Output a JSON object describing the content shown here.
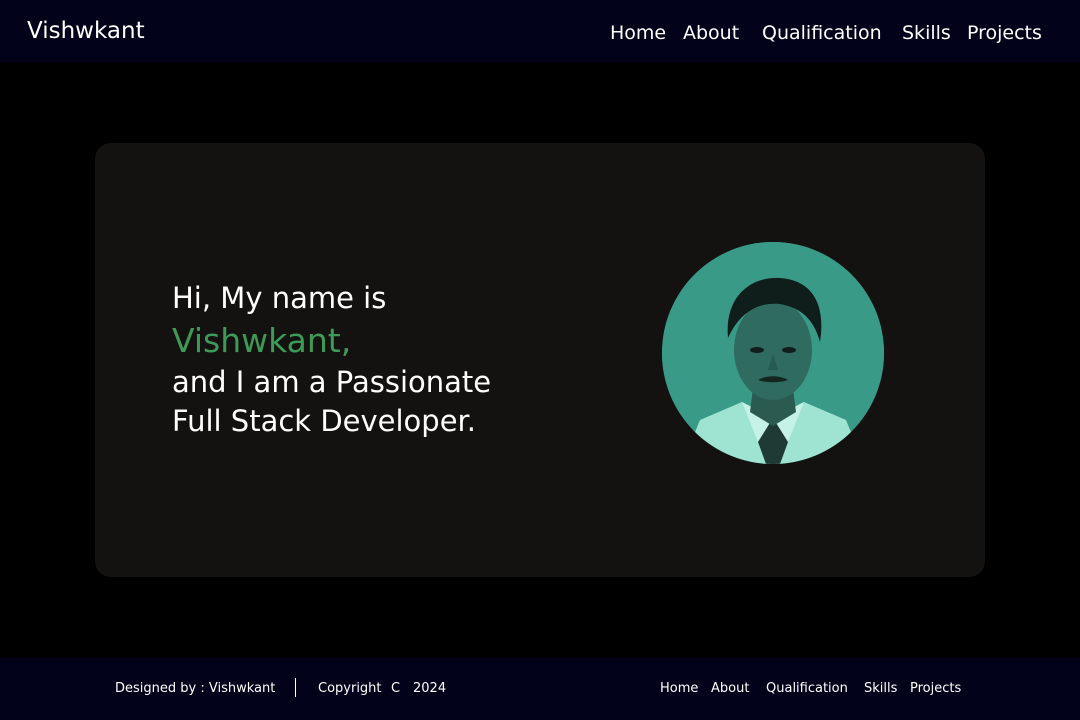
{
  "navbar": {
    "brand": "Vishwkant",
    "links": [
      "Home",
      "About",
      "Qualification",
      "Skills",
      "Projects"
    ]
  },
  "hero": {
    "line1": "Hi, My name is",
    "name": "Vishwkant,",
    "line3": "and I am a Passionate",
    "line4": "Full Stack Developer."
  },
  "footer": {
    "designed_by": "Designed by : Vishwkant",
    "copyright": "Copyright",
    "copyright_symbol": "C",
    "year": "2024",
    "links": [
      "Home",
      "About",
      "Qualification",
      "Skills",
      "Projects"
    ]
  },
  "colors": {
    "nav_background": "#02021a",
    "page_background": "#000000",
    "card_background": "#131211",
    "accent_name": "#3e9a57",
    "avatar_tint": "#3a9a88"
  },
  "icons": {
    "avatar": "profile-photo"
  }
}
